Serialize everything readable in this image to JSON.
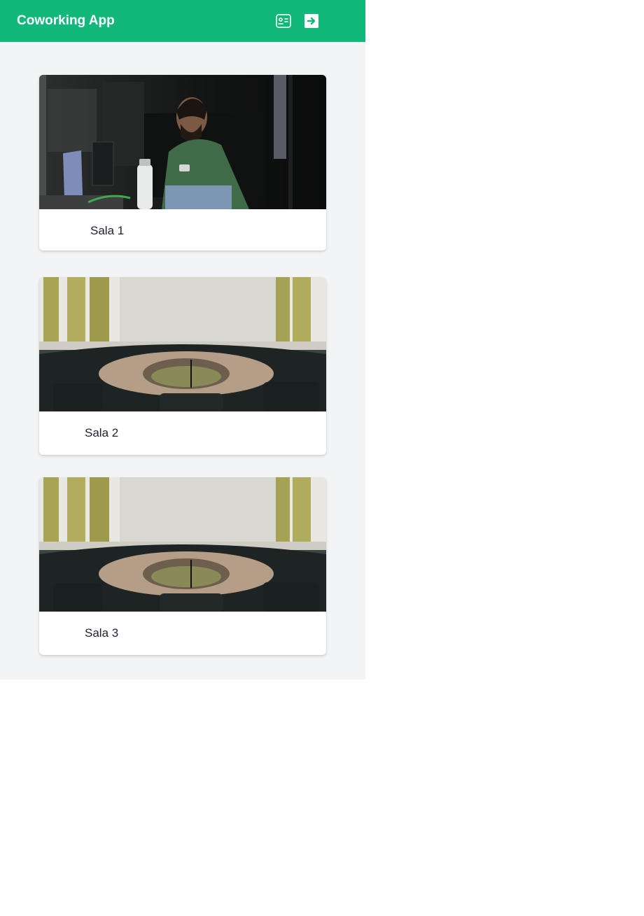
{
  "app": {
    "title": "Coworking App",
    "accent_color": "#12b77a",
    "background_color": "#f2f4f5"
  },
  "header": {
    "icons": [
      {
        "name": "id-card-icon"
      },
      {
        "name": "logout-icon"
      }
    ]
  },
  "rooms": [
    {
      "label": "Sala 1",
      "image": "person-working-at-laptop-photo"
    },
    {
      "label": "Sala 2",
      "image": "conference-room-photo"
    },
    {
      "label": "Sala 3",
      "image": "conference-room-photo"
    }
  ]
}
